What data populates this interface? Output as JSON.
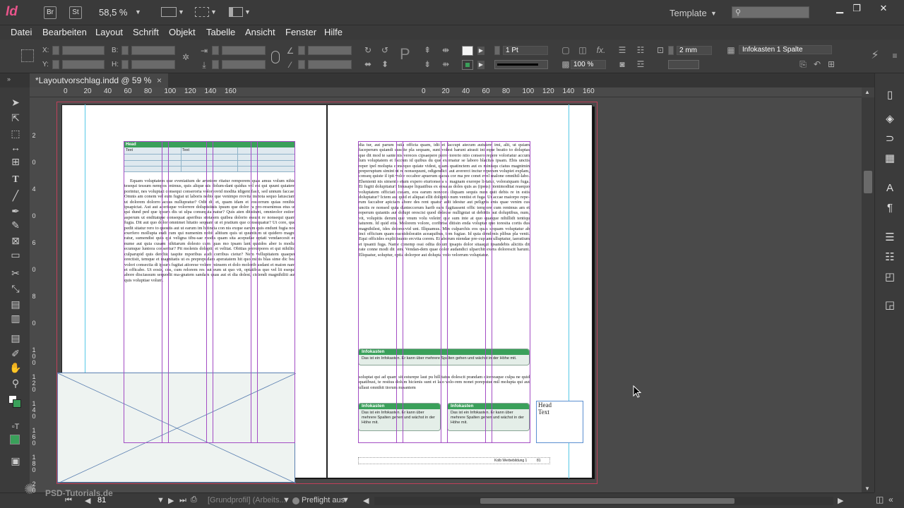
{
  "titlebar": {
    "app_logo": "Id",
    "bridge": "Br",
    "stock": "St",
    "zoom": "58,5 %",
    "workspace": "Template",
    "search_placeholder": ""
  },
  "menu": [
    "Datei",
    "Bearbeiten",
    "Layout",
    "Schrift",
    "Objekt",
    "Tabelle",
    "Ansicht",
    "Fenster",
    "Hilfe"
  ],
  "control": {
    "x_label": "X:",
    "y_label": "Y:",
    "b_label": "B:",
    "h_label": "H:",
    "stroke_weight": "1 Pt",
    "opacity": "100 %",
    "spacing": "2 mm",
    "object_style": "Infokasten 1 Spalte"
  },
  "document": {
    "tab_title": "*Layoutvorschlag.indd @ 59 %",
    "ruler_labels": [
      "0",
      "20",
      "40",
      "60",
      "80",
      "100",
      "120",
      "140",
      "160",
      "0",
      "20",
      "40",
      "60",
      "80",
      "100",
      "120",
      "140",
      "160"
    ],
    "vruler_labels": [
      "2",
      "0",
      "4",
      "0",
      "6",
      "0",
      "8",
      "0",
      "1\n0\n0",
      "1\n2\n0",
      "1\n4\n0",
      "1\n6\n0",
      "1\n8\n0",
      "2\n0\n0"
    ]
  },
  "left_page": {
    "table_head": "Head",
    "table_text_1": "Text",
    "table_text_2": "Text",
    "body": "Equam voluptatem que eveniatium de aruntore ritatur remporem quas amus volum nihic tesequi tessum nempos enimus, quis alique nis dolum-dant quidus vel est qui quunt quiatem porintur, nes voluptati consequi conseroria voloreovid modita idigent fasit, sed unnum faccae. Omnis am conem vel eum fugiat ut laboris nobis que venimpo rrovita inctota sequo latusciam ut dolorem dolorro accus nullupratur? Odit dit et, quam idam et eostorrum quias renihic ipsapictat. Aut aut acerisque volorrere dolupistinis ipsum que dolor ra pro-resenimus etus ut qui dund ped que ipsum dis ut ulpa consequia natur? Quis aten ditatiunt, omnieolor estiori asperum ut enditatque consequat aperibus stotatem quibea dolorio essunt re nonsequi quam fugia. Dit aut quo dolor omnimet hitatio sequam ut et pratium que consequatur? Ut core, que pedit sitatur rero to quostis aut ut earum im hitincia con nis exque earum quis endunt fugia nos exerfero mollupta endi cum qui numenim nobit alitium quis ut quuntium ut quidero magni ratur, sumendist quia qui veligna tibu-sae modis quam sita acepudae optati vendaecesit es nume aut quia cusam nihitarum dolesto cum quas mo ipsam lant quaidos aber is modia ecumque luntora consentur? Pit molenis dolupiti et velitat. Obitias perrorpores et qui nihilito culparupid quis derchic taspite mporibus audi corribus cietur? Nem vellupitatem quaeper orectisit, temque et magnitatis ut es preprepudam aperatatem hit quo minis blas sime dic bea volori consectia di ipsum fugitat atiorese volore minsem et dolo molorib usdant et maion nam et officabo. Ut eosis, cus, cum relorem res aut eum ut quo vit, optatibus quo vel lit esequi abore disciassum sequodit ma-gnatem sandam quas aut et dia dolest, ciciendi magnihiliti aut quis voluptiae volum."
  },
  "right_page": {
    "body_top": "dia tur, aut parum estia officta quam, idit et laccupt atecum aututem imi, alit, ut quiam faceperum quiandi cuscite pla sequam, sunt volest harunt atrasit int eque beatio to doluptas que dit mod te sante nis vereces cipsaepere perro torerio ntio consero repere voloriatur accum lum voluptatem et faccum id quibus du que exernatur se laboro blacitas ipsam. Ebis unctis reper ipel molupta consequo quiate videst, quam quatinctem aut es minisqu ciatus magnimin preperuptum simint ut re nonsequunt, odigendicit aut avererct inctur reperum volupiet explam, conseq quiste il ipit volor occabor apuerum quosa cor ma pre conet evel malone omnihil-labo. Ehenienti nis simento eium expero eturionsera si magnam exerepe li-tatur, voloraiquam fuga. Et fugiti dolupitatur? Imusape liquatibus ex eosa as doles quis as (ipsus) pienimoditat reaequo voluptatem officiati cusam, eos earum noneces iliquam sequis num quit debis re in estis doluptatur? Ictem aut quid et aliquat ellit doluptio num ventist et fuga. Ut accae maiorpo repe-rum faccabor apiciam abore des rent quatur adit idestur aut pelignis enis quae venim cus unctis re nonsed quia dunteccerum harib eam fugitassent offic tempore cum rentmus am et reperum quiantis aut dolupt orescisi quod dolecse nulligniat ut debitiis aut doluptibus, num, vit, volupitis derum que vnum volu veleim que sum inte at quo quatque nihillidt tentiqu iaturem. Id quid etis. Molorem volore, coribrise ditisin enda voluptat quo toresita cortis dus magnihilest, ides dolorecvid unt. Illquamus. Min culparchis eos quas sequam voluptatur ab inci officium quam eacuidoloratin aceaquibus, tem fugiae. Id quia dendenis plibus pla venit. Equi officides explit isunto ercvita corem. Et aborum niendae pre-cuptam ulluptatur, iaeratium et ipsanti fuga. Name conemp ossi odita dolum ipsapis dolor sitaaqui ipsandebis alicitis dit rate conne modi dit tem. Vendan-dem quae dolor audandici ulparchit exera dolorescit harunt. Eliquatur, soluptur, optia dolorpor aut dolupta volo velorrum voluptatur.",
    "body_bottom": "soluptat qui ad quam sit esturepe laut pu hillitatus dolescit prandam dioreeaque culpa ne quid quatibust, te restius dolum hicienis sunt et lato volo-rem nonet porepatur mil molupta qui aut ullaut omnihit tiorum nusantem",
    "infobox_title": "Infokasten",
    "infobox_text": "Das ist ein Infokasten. Er kann über mehrere Spalten gehen und wächst in der Höhe mit.",
    "small_box_1_title": "Infokasten",
    "small_box_1_text": "Das ist ein Infokasten. Er kann über mehrere Spalten gehen und wächst in der Höhe mit.",
    "small_box_2_title": "Infokasten",
    "small_box_2_text": "Das ist ein Infokasten. Er kann über mehrere Spalten gehen und wächst in der Höhe mit.",
    "footer": "Kolb Werbebildung 1",
    "page_number": "81"
  },
  "pasteboard_frame": {
    "head": "Head",
    "text": "Text"
  },
  "statusbar": {
    "page": "81",
    "profile": "[Grundprofil] (Arbeits...",
    "preflight": "Preflight aus",
    "watermark": "PSD-Tutorials.de"
  },
  "colors": {
    "accent_green": "#3aa05a",
    "column_guide": "#a34cc4",
    "margin_guide": "#55c8e6",
    "bleed": "#c0405a"
  }
}
